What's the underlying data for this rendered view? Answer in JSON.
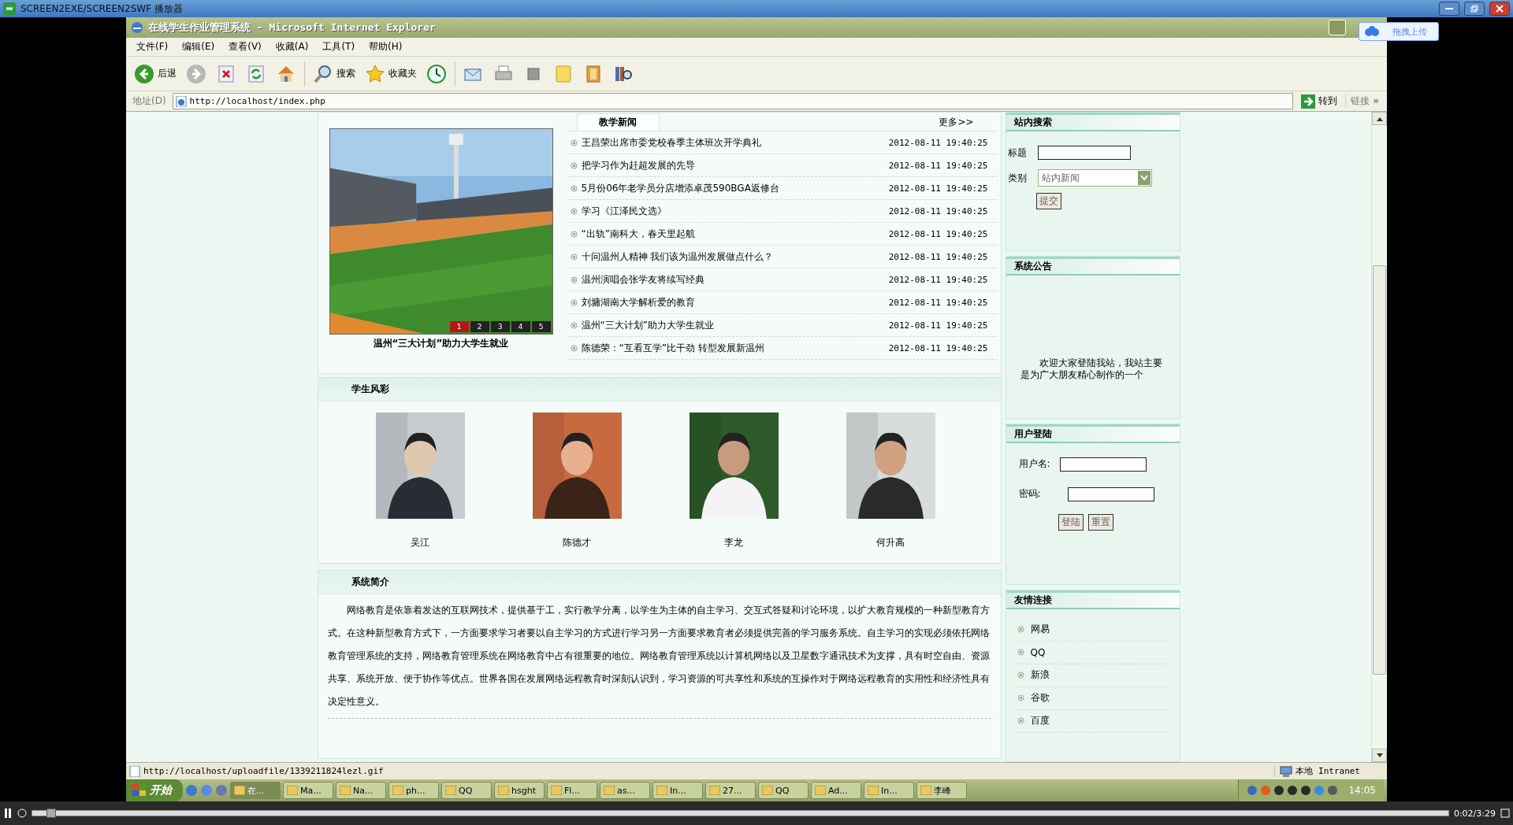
{
  "player": {
    "title": "SCREEN2EXE/SCREEN2SWF 播放器",
    "time": "0:02/3:29",
    "level": 0.01
  },
  "upload_badge": "拖拽上传",
  "browser": {
    "title": "在线学生作业管理系统 - Microsoft Internet Explorer",
    "menu": [
      "文件(F)",
      "编辑(E)",
      "查看(V)",
      "收藏(A)",
      "工具(T)",
      "帮助(H)"
    ],
    "toolbar": [
      {
        "kind": "back",
        "label": "后退"
      },
      {
        "kind": "forward"
      },
      {
        "kind": "stop"
      },
      {
        "kind": "refresh"
      },
      {
        "kind": "home"
      },
      {
        "kind": "search",
        "label": "搜索"
      },
      {
        "kind": "favorites",
        "label": "收藏夹"
      },
      {
        "kind": "history"
      },
      {
        "kind": "mail"
      },
      {
        "kind": "print"
      },
      {
        "kind": "edit"
      },
      {
        "kind": "note"
      },
      {
        "kind": "folder"
      },
      {
        "kind": "research"
      }
    ],
    "address_label": "地址(D)",
    "address": "http://localhost/index.php",
    "go": "转到",
    "links": "链接",
    "links_more": "»",
    "status": "http://localhost/uploadfile/1339211824lezl.gif",
    "zone": "本地 Intranet"
  },
  "news": {
    "tab": "教学新闻",
    "more": "更多>>",
    "slide_caption": "温州“三大计划”助力大学生就业",
    "slides": [
      {
        "label": "1",
        "selected": true
      },
      {
        "label": "2",
        "selected": false
      },
      {
        "label": "3",
        "selected": false
      },
      {
        "label": "4",
        "selected": false
      },
      {
        "label": "5",
        "selected": false
      }
    ],
    "items": [
      {
        "title": "王昌荣出席市委党校春季主体班次开学典礼",
        "time": "2012-08-11 19:40:25"
      },
      {
        "title": "把学习作为赶超发展的先导",
        "time": "2012-08-11 19:40:25"
      },
      {
        "title": "5月份06年老学员分店增添卓茂590BGA返修台",
        "time": "2012-08-11 19:40:25"
      },
      {
        "title": "学习《江泽民文选》",
        "time": "2012-08-11 19:40:25"
      },
      {
        "title": "“出轨”南科大，春天里起航",
        "time": "2012-08-11 19:40:25"
      },
      {
        "title": "十问温州人精神 我们该为温州发展做点什么？",
        "time": "2012-08-11 19:40:25"
      },
      {
        "title": "温州演唱会张学友将续写经典",
        "time": "2012-08-11 19:40:25"
      },
      {
        "title": "刘墉湖南大学解析爱的教育",
        "time": "2012-08-11 19:40:25"
      },
      {
        "title": "温州“三大计划”助力大学生就业",
        "time": "2012-08-11 19:40:25"
      },
      {
        "title": "陈德荣：“互看互学”比干劲 转型发展新温州",
        "time": "2012-08-11 19:40:25"
      }
    ]
  },
  "students": {
    "title": "学生风彩",
    "people": [
      {
        "name": "吴江"
      },
      {
        "name": "陈德才"
      },
      {
        "name": "李龙"
      },
      {
        "name": "何升高"
      }
    ]
  },
  "intro": {
    "title": "系统简介",
    "text": "网络教育是依靠着发达的互联网技术，提供基于工，实行教学分离，以学生为主体的自主学习、交互式答疑和讨论环境，以扩大教育规模的一种新型教育方式。在这种新型教育方式下，一方面要求学习者要以自主学习的方式进行学习另一方面要求教育者必须提供完善的学习服务系统。自主学习的实现必须依托网络教育管理系统的支持，网络教育管理系统在网络教育中占有很重要的地位。网络教育管理系统以计算机网络以及卫星数字通讯技术为支撑，具有时空自由、资源共享、系统开放、便于协作等优点。世界各国在发展网络远程教育时深刻认识到，学习资源的可共享性和系统的互操作对于网络远程教育的实用性和经济性具有决定性意义。"
  },
  "sidebar": {
    "search": {
      "title": "站内搜索",
      "title_label": "标题",
      "category_label": "类别",
      "category_value": "站内新闻",
      "submit": "提交"
    },
    "notice": {
      "title": "系统公告",
      "text": "欢迎大家登陆我站，我站主要是为广大朋友精心制作的一个"
    },
    "login": {
      "title": "用户登陆",
      "username_label": "用户名:",
      "password_label": "密码:",
      "buttons": [
        "登陆",
        "重置"
      ]
    },
    "links": {
      "title": "友情连接",
      "items": [
        "网易",
        "QQ",
        "新浪",
        "谷歌",
        "百度"
      ]
    }
  },
  "taskbar": {
    "start": "开始",
    "tasks": [
      {
        "label": "在...",
        "selected": true
      },
      {
        "label": "Ma...",
        "selected": false
      },
      {
        "label": "Na...",
        "selected": false
      },
      {
        "label": "ph...",
        "selected": false
      },
      {
        "label": "QQ",
        "selected": false
      },
      {
        "label": "hsght",
        "selected": false
      },
      {
        "label": "Fl...",
        "selected": false
      },
      {
        "label": "as...",
        "selected": false
      },
      {
        "label": "In...",
        "selected": false
      },
      {
        "label": "27...",
        "selected": false
      },
      {
        "label": "QQ",
        "selected": false
      },
      {
        "label": "Ad...",
        "selected": false
      },
      {
        "label": "In...",
        "selected": false
      },
      {
        "label": "李峰",
        "selected": false
      }
    ],
    "clock": "14:05"
  }
}
